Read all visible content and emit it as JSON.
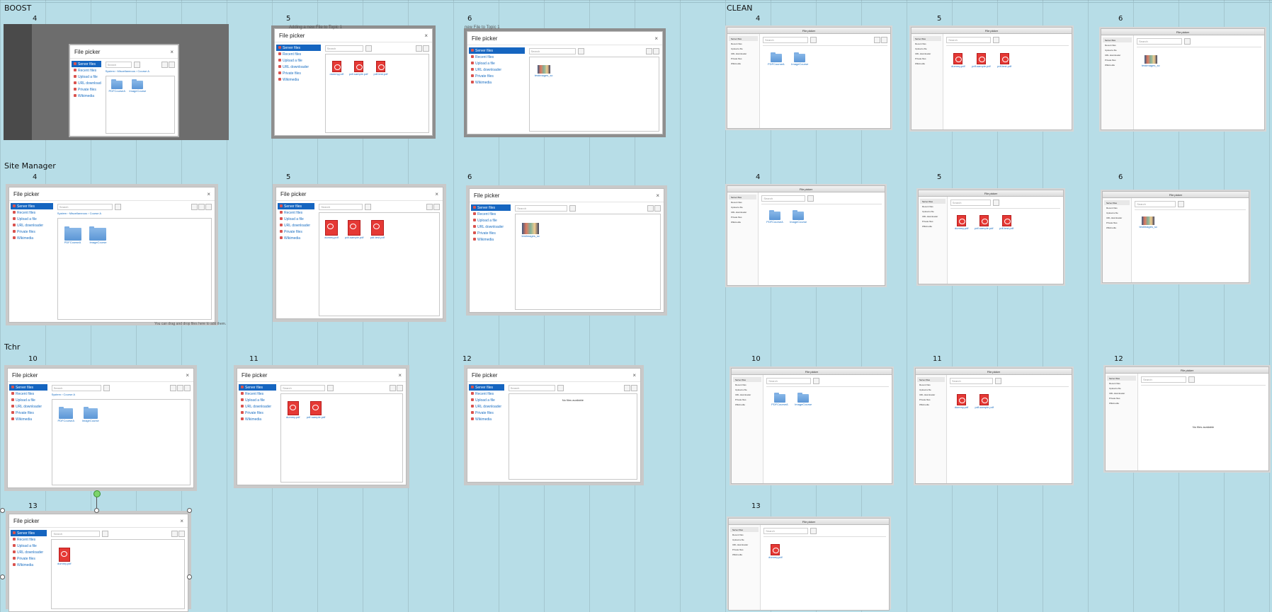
{
  "sections": {
    "boost": "BOOST",
    "clean": "CLEAN",
    "site_manager": "Site Manager",
    "tchr": "Tchr"
  },
  "picker": {
    "title": "File picker",
    "close": "×",
    "search_placeholder": "Search",
    "nav": [
      "Server files",
      "Recent files",
      "Upload a file",
      "URL downloader",
      "Private files",
      "Wikimedia"
    ],
    "no_files": "No files available"
  },
  "crumbs": {
    "boost4": [
      "System",
      "Miscellaneous",
      "Course A"
    ],
    "tchr10": [
      "System",
      "Course A"
    ]
  },
  "files": {
    "folders_a": [
      "PDFCourseA",
      "ImageCourse"
    ],
    "pdfs_three": [
      "dummy.pdf",
      "pdf-sample.pdf",
      "pdf-test.pdf"
    ],
    "pdfs_two": [
      "dummy.pdf",
      "pdf-sample.pdf"
    ],
    "pdfs_one": [
      "dummy.pdf"
    ],
    "image": [
      "testimages_sc"
    ]
  },
  "steps": {
    "boost": [
      "4",
      "5",
      "6"
    ],
    "clean_top": [
      "4",
      "5",
      "6"
    ],
    "site": [
      "4",
      "5",
      "6"
    ],
    "clean_mid": [
      "4",
      "5",
      "6"
    ],
    "tchr": [
      "10",
      "11",
      "12",
      "13"
    ],
    "clean_bot": [
      "10",
      "11",
      "12",
      "13"
    ]
  },
  "fragments": {
    "topic": "Adding a new File to Topic 1",
    "topic_short": "new File to Topic 1",
    "drop_hint": "You can drag and drop files here to add them."
  }
}
